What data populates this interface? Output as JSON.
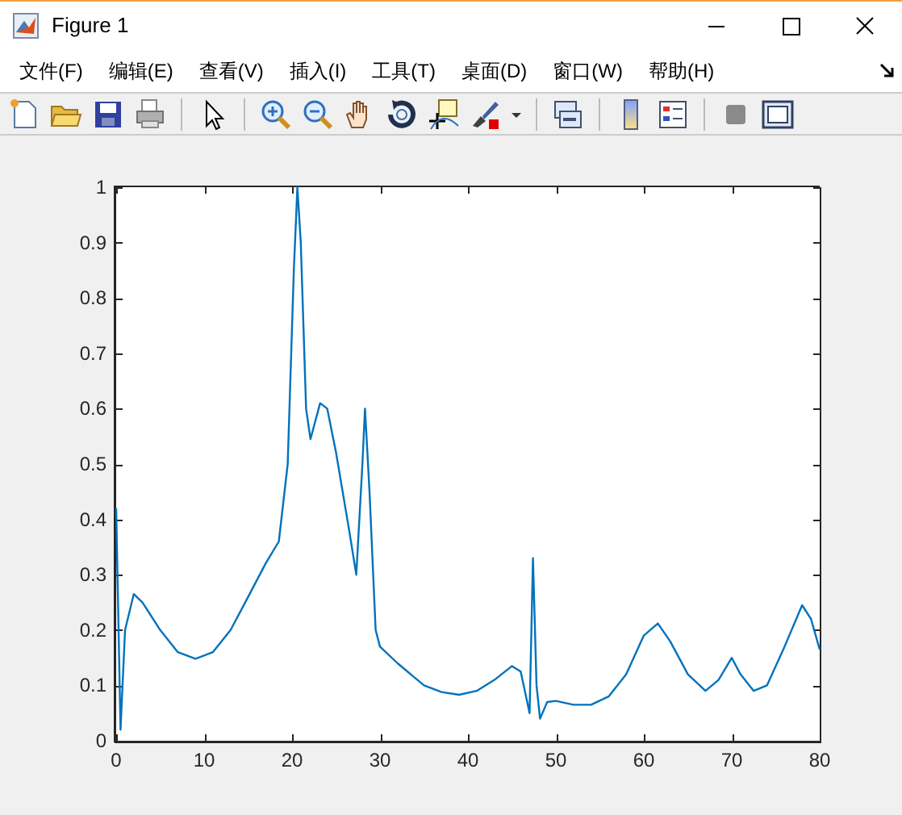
{
  "window": {
    "title": "Figure 1"
  },
  "menu": [
    {
      "label": "文件(F)"
    },
    {
      "label": "编辑(E)"
    },
    {
      "label": "查看(V)"
    },
    {
      "label": "插入(I)"
    },
    {
      "label": "工具(T)"
    },
    {
      "label": "桌面(D)"
    },
    {
      "label": "窗口(W)"
    },
    {
      "label": "帮助(H)"
    }
  ],
  "axes": {
    "chart_data": {
      "type": "line",
      "x": [
        0,
        0.5,
        1,
        2,
        3,
        5,
        7,
        9,
        11,
        13,
        15,
        17,
        18.5,
        19.5,
        20.2,
        20.6,
        21,
        21.6,
        22.1,
        23.2,
        24,
        25,
        26.5,
        27.3,
        28,
        28.3,
        28.8,
        29.5,
        30,
        32,
        35,
        37,
        39,
        41,
        43,
        45,
        46,
        47,
        47.4,
        47.8,
        48.2,
        49,
        50,
        52,
        54,
        56,
        58,
        60,
        61.6,
        63,
        65,
        67,
        68.5,
        70,
        71,
        72.5,
        74,
        76,
        78,
        79,
        80
      ],
      "series": [
        {
          "color": "#0072bd",
          "values": [
            0.42,
            0.02,
            0.2,
            0.265,
            0.25,
            0.2,
            0.16,
            0.148,
            0.16,
            0.2,
            0.26,
            0.32,
            0.36,
            0.5,
            0.85,
            1.0,
            0.9,
            0.6,
            0.545,
            0.61,
            0.6,
            0.52,
            0.38,
            0.3,
            0.5,
            0.6,
            0.45,
            0.2,
            0.17,
            0.14,
            0.1,
            0.088,
            0.083,
            0.09,
            0.11,
            0.135,
            0.125,
            0.05,
            0.33,
            0.1,
            0.04,
            0.07,
            0.072,
            0.065,
            0.065,
            0.08,
            0.12,
            0.19,
            0.212,
            0.18,
            0.12,
            0.09,
            0.11,
            0.15,
            0.12,
            0.09,
            0.1,
            0.17,
            0.245,
            0.22,
            0.165
          ]
        }
      ],
      "xlim": [
        0,
        80
      ],
      "ylim": [
        0,
        1
      ],
      "xticks": [
        0,
        10,
        20,
        30,
        40,
        50,
        60,
        70,
        80
      ],
      "yticks": [
        0,
        0.1,
        0.2,
        0.3,
        0.4,
        0.5,
        0.6,
        0.7,
        0.8,
        0.9,
        1
      ]
    }
  }
}
